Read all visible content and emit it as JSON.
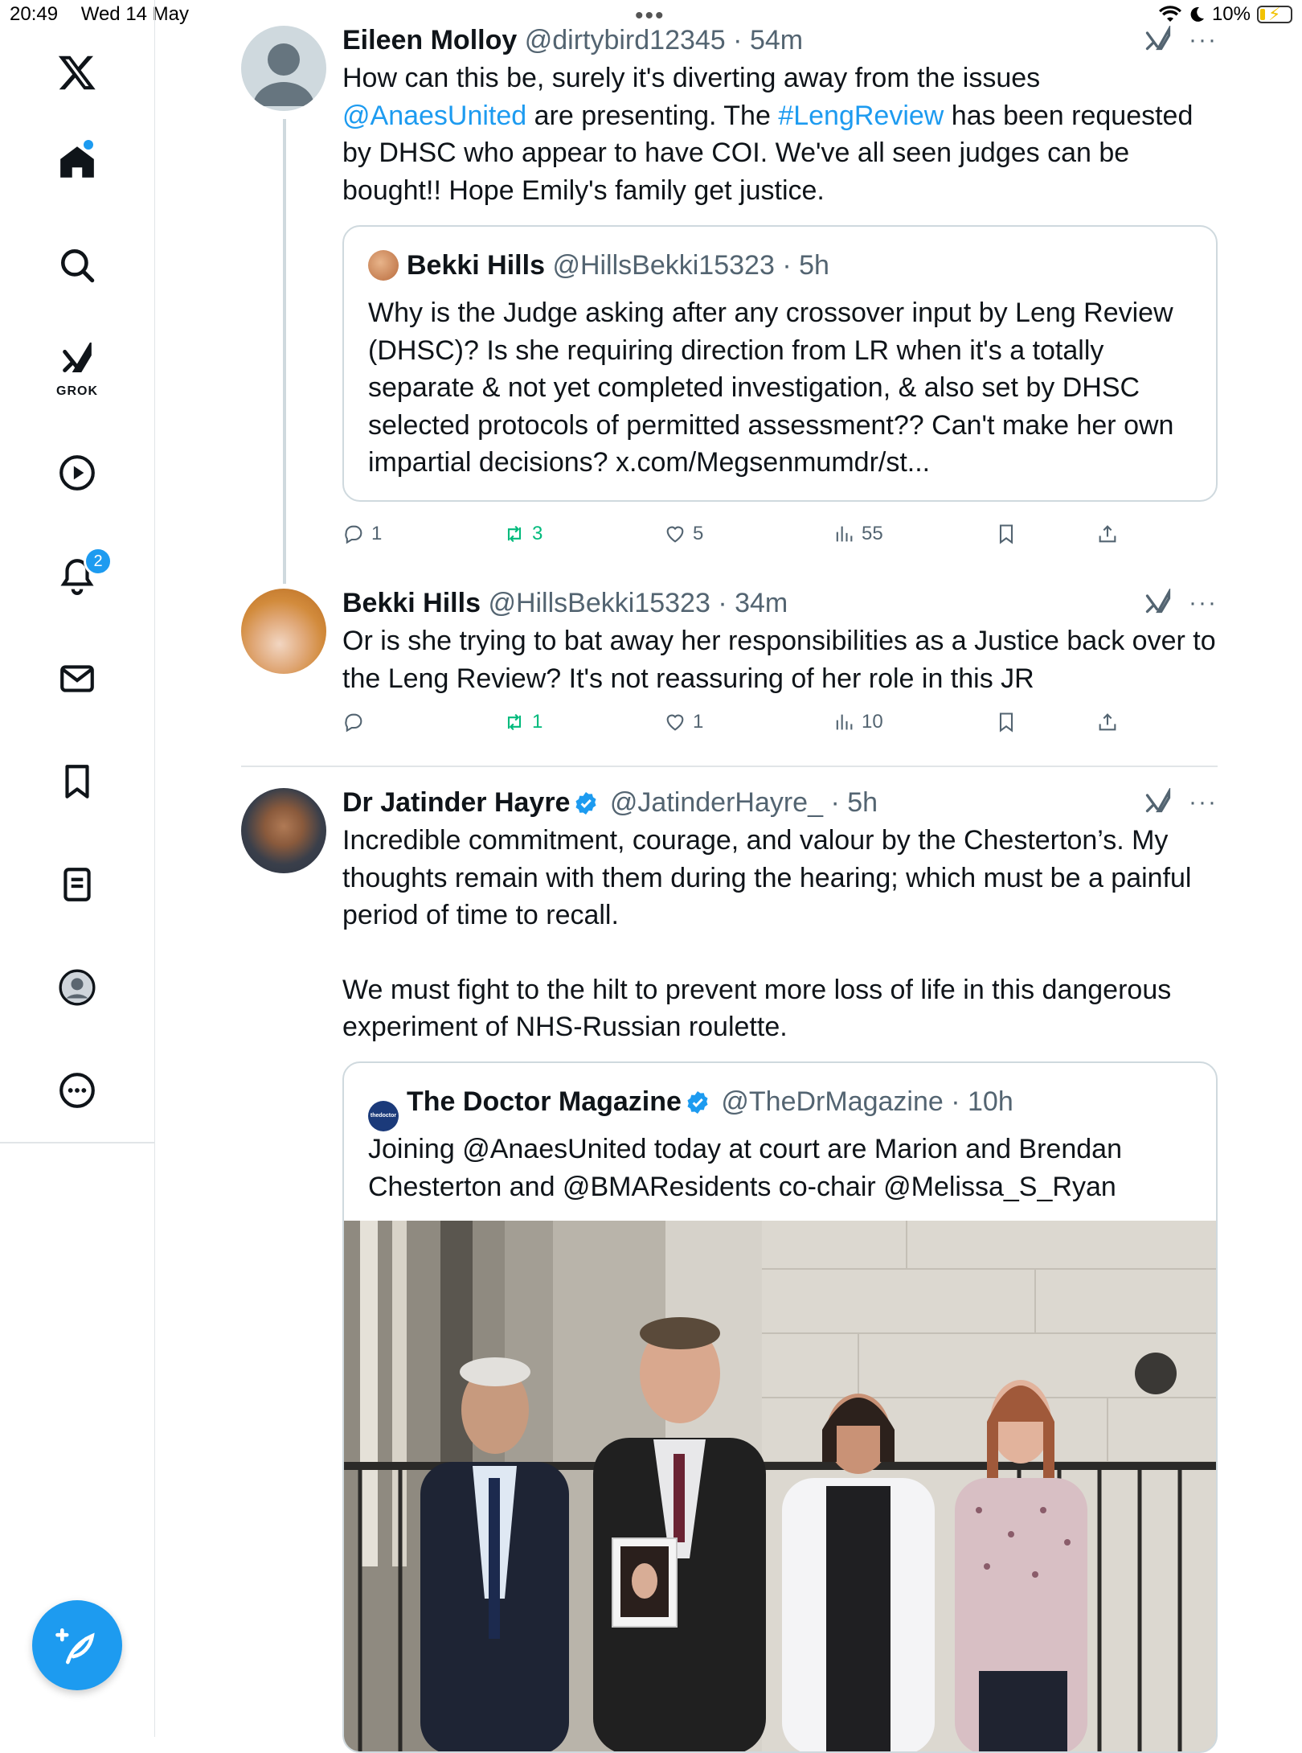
{
  "status_bar": {
    "time": "20:49",
    "date": "Wed 14 May",
    "battery": "10%"
  },
  "sidebar": {
    "grok_label": "GROK",
    "notifications_badge": "2",
    "items": [
      "home-icon",
      "search-icon",
      "grok-icon",
      "video-icon",
      "notifications-icon",
      "messages-icon",
      "bookmarks-icon",
      "lists-icon",
      "profile-icon",
      "more-icon"
    ]
  },
  "tweets": [
    {
      "name": "Eileen Molloy",
      "handle": "@dirtybird12345",
      "time": "· 54m",
      "text_parts": [
        "How can this be, surely it's diverting away from the issues ",
        "@AnaesUnited",
        " are presenting. The ",
        "#LengReview",
        " has been requested by DHSC who appear to have COI. We've all seen judges can be bought!! Hope Emily's family get justice."
      ],
      "quote": {
        "name": "Bekki Hills",
        "handle": "@HillsBekki15323",
        "time": "· 5h",
        "text": "Why is the Judge asking after any crossover input by Leng Review (DHSC)? Is she requiring  direction from LR when it's a totally separate & not yet completed investigation, & also set by DHSC selected protocols of permitted assessment?? Can't make her own impartial decisions? x.com/Megsenmumdr/st..."
      },
      "stats": {
        "replies": "1",
        "reposts": "3",
        "likes": "5",
        "views": "55"
      }
    },
    {
      "name": "Bekki Hills",
      "handle": "@HillsBekki15323",
      "time": "· 34m",
      "text": "Or is she trying to bat away her responsibilities as a Justice back over to the Leng Review? It's not reassuring of her role in this JR",
      "stats": {
        "replies": "",
        "reposts": "1",
        "likes": "1",
        "views": "10"
      }
    },
    {
      "name": "Dr Jatinder Hayre",
      "handle": "@JatinderHayre_",
      "time": "· 5h",
      "text_p1": "Incredible commitment, courage, and valour by the Chesterton’s. My thoughts remain with them during the hearing; which must be a painful period of time to recall.",
      "text_p2": "We must fight to the hilt to prevent more loss of life in this dangerous experiment of NHS-Russian roulette.",
      "quote": {
        "name": "The Doctor Magazine",
        "handle": "@TheDrMagazine",
        "time": "· 10h",
        "avatar_text": "thedoctor",
        "text": "Joining @AnaesUnited today at court are Marion and Brendan Chesterton and @BMAResidents co-chair @Melissa_S_Ryan"
      }
    }
  ],
  "colors": {
    "accent": "#1d9bf0",
    "repost_green": "#00ba7c",
    "muted": "#536471"
  }
}
